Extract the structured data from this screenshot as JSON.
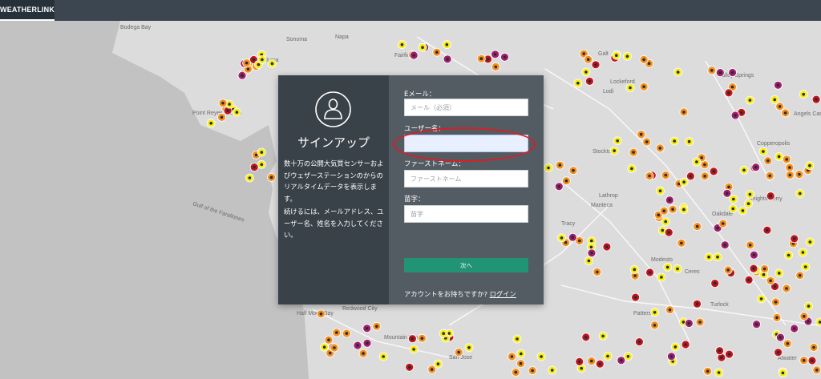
{
  "topbar": {
    "brand": "WEATHERLINK"
  },
  "map": {
    "labels": [
      {
        "text": "Bodega Bay"
      },
      {
        "text": "Sonoma"
      },
      {
        "text": "Napa"
      },
      {
        "text": "Fairfield"
      },
      {
        "text": "Petaluma"
      },
      {
        "text": "Galt"
      },
      {
        "text": "Lodi"
      },
      {
        "text": "Lockeford"
      },
      {
        "text": "Valley Springs"
      },
      {
        "text": "Point Reyes Station"
      },
      {
        "text": "Stockton"
      },
      {
        "text": "Copperopolis"
      },
      {
        "text": "Gulf of the Farallones"
      },
      {
        "text": "Lathrop"
      },
      {
        "text": "Manteca"
      },
      {
        "text": "Knights Ferry"
      },
      {
        "text": "Oakdale"
      },
      {
        "text": "Tracy"
      },
      {
        "text": "Modesto"
      },
      {
        "text": "Ceres"
      },
      {
        "text": "Turlock"
      },
      {
        "text": "Patterson"
      },
      {
        "text": "Redwood City"
      },
      {
        "text": "Half Moon Bay"
      },
      {
        "text": "Mountain View"
      },
      {
        "text": "San Jose"
      },
      {
        "text": "Atwater"
      },
      {
        "text": "Angels Camp"
      }
    ],
    "colors": {
      "land": "#dcdcdc",
      "water": "#c2c2c2",
      "orange": "#f4901e",
      "yellow": "#f4ec1c",
      "red": "#c0141e",
      "magenta": "#a01e6e"
    }
  },
  "signup": {
    "title": "サインアップ",
    "description1": "数十万の公開大気質センサーおよびウェザーステーションのからのリアルタイムデータを表示します。",
    "description2": "続けるには、メールアドレス、ユーザー名、姓名を入力してください。",
    "email": {
      "label": "Eメール：",
      "placeholder": "メール（必須）",
      "value": ""
    },
    "username": {
      "label": "ユーザー名：",
      "placeholder": "",
      "value": ""
    },
    "firstname": {
      "label": "ファーストネーム：",
      "placeholder": "ファーストネーム",
      "value": ""
    },
    "lastname": {
      "label": "苗字：",
      "placeholder": "苗字",
      "value": ""
    },
    "submit_label": "次へ",
    "footer_text": "アカウントをお持ちですか?",
    "login_label": "ログイン"
  }
}
